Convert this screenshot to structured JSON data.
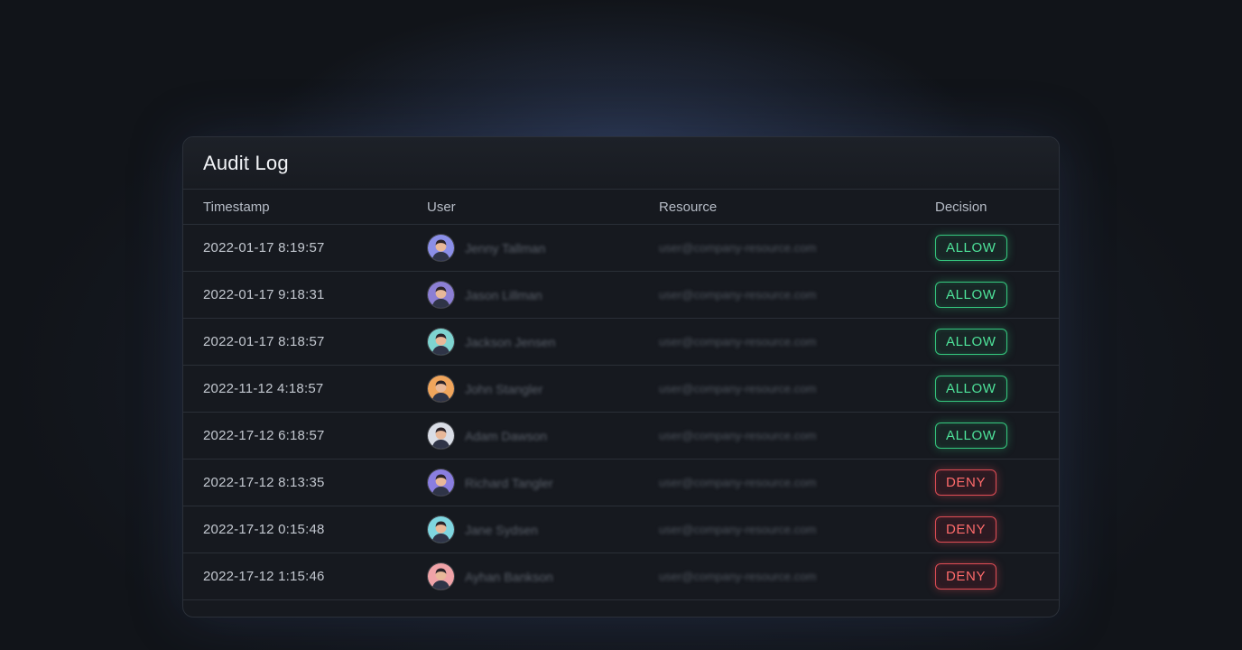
{
  "title": "Audit Log",
  "columns": {
    "timestamp": "Timestamp",
    "user": "User",
    "resource": "Resource",
    "decision": "Decision"
  },
  "rows": [
    {
      "timestamp": "2022-01-17 8:19:57",
      "user": "Jenny Tallman",
      "avatar_bg": "#8b8fe8",
      "resource": "user@company-resource.com",
      "decision": "ALLOW"
    },
    {
      "timestamp": "2022-01-17 9:18:31",
      "user": "Jason Lillman",
      "avatar_bg": "#8c7fd4",
      "resource": "user@company-resource.com",
      "decision": "ALLOW"
    },
    {
      "timestamp": "2022-01-17 8:18:57",
      "user": "Jackson Jensen",
      "avatar_bg": "#7fd4d0",
      "resource": "user@company-resource.com",
      "decision": "ALLOW"
    },
    {
      "timestamp": "2022-11-12 4:18:57",
      "user": "John Stangler",
      "avatar_bg": "#f0a55c",
      "resource": "user@company-resource.com",
      "decision": "ALLOW"
    },
    {
      "timestamp": "2022-17-12 6:18:57",
      "user": "Adam Dawson",
      "avatar_bg": "#d9dde6",
      "resource": "user@company-resource.com",
      "decision": "ALLOW"
    },
    {
      "timestamp": "2022-17-12 8:13:35",
      "user": "Richard Tangler",
      "avatar_bg": "#8a7ee0",
      "resource": "user@company-resource.com",
      "decision": "DENY"
    },
    {
      "timestamp": "2022-17-12 0:15:48",
      "user": "Jane Sydsen",
      "avatar_bg": "#7fd6e0",
      "resource": "user@company-resource.com",
      "decision": "DENY"
    },
    {
      "timestamp": "2022-17-12 1:15:46",
      "user": "Ayhan Bankson",
      "avatar_bg": "#f0a3a8",
      "resource": "user@company-resource.com",
      "decision": "DENY"
    }
  ],
  "colors": {
    "allow": "#35c97f",
    "deny": "#e04d55",
    "background": "#111419",
    "card": "#16191f"
  }
}
